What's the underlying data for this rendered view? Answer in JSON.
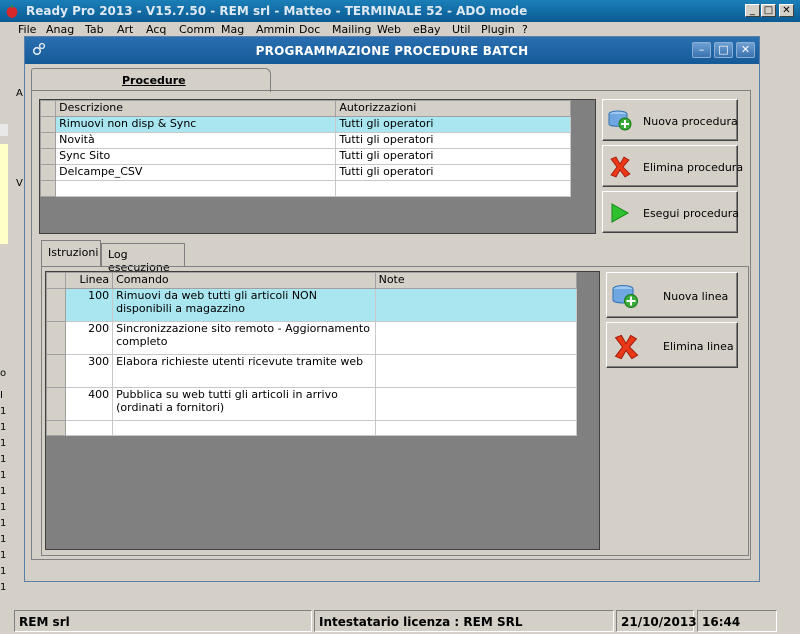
{
  "app": {
    "title": "Ready Pro 2013 - V15.7.50 - REM srl - Matteo - TERMINALE 52 - ADO mode",
    "menu": [
      "File",
      "Anag",
      "Tab",
      "Art",
      "Acq",
      "Comm",
      "Mag",
      "Ammin",
      "Doc",
      "Mailing",
      "Web",
      "eBay",
      "Util",
      "Plugin",
      "?"
    ],
    "left_fragments": [
      "A",
      "V",
      "o",
      "I",
      "1",
      "1",
      "1",
      "1",
      "1",
      "1",
      "1",
      "1",
      "1",
      "1",
      "1",
      "1"
    ]
  },
  "dialog": {
    "title": "PROGRAMMAZIONE PROCEDURE BATCH",
    "tab_procedure": "Procedure",
    "procedures_grid": {
      "columns": [
        "Descrizione",
        "Autorizzazioni"
      ],
      "rows": [
        {
          "descrizione": "Rimuovi non disp & Sync",
          "autorizzazioni": "Tutti gli operatori"
        },
        {
          "descrizione": "Novità",
          "autorizzazioni": "Tutti gli operatori"
        },
        {
          "descrizione": "Sync Sito",
          "autorizzazioni": "Tutti gli operatori"
        },
        {
          "descrizione": "Delcampe_CSV",
          "autorizzazioni": "Tutti gli operatori"
        }
      ]
    },
    "buttons": {
      "nuova_procedura": "Nuova procedura",
      "elimina_procedura": "Elimina procedura",
      "esegui_procedura": "Esegui procedura",
      "nuova_linea": "Nuova linea",
      "elimina_linea": "Elimina linea"
    },
    "subtabs": {
      "istruzioni": "Istruzioni",
      "log": "Log esecuzione"
    },
    "lines_grid": {
      "columns": [
        "Linea",
        "Comando",
        "Note"
      ],
      "rows": [
        {
          "linea": "100",
          "comando": "Rimuovi da web tutti gli articoli NON disponibili a magazzino",
          "note": ""
        },
        {
          "linea": "200",
          "comando": "Sincronizzazione sito remoto - Aggiornamento completo",
          "note": ""
        },
        {
          "linea": "300",
          "comando": "Elabora richieste utenti ricevute tramite web",
          "note": ""
        },
        {
          "linea": "400",
          "comando": "Pubblica su web tutti gli articoli in arrivo (ordinati a fornitori)",
          "note": ""
        }
      ]
    }
  },
  "status": {
    "company": "REM srl",
    "license": "Intestatario licenza : REM SRL",
    "date": "21/10/2013",
    "time": "16:44"
  }
}
